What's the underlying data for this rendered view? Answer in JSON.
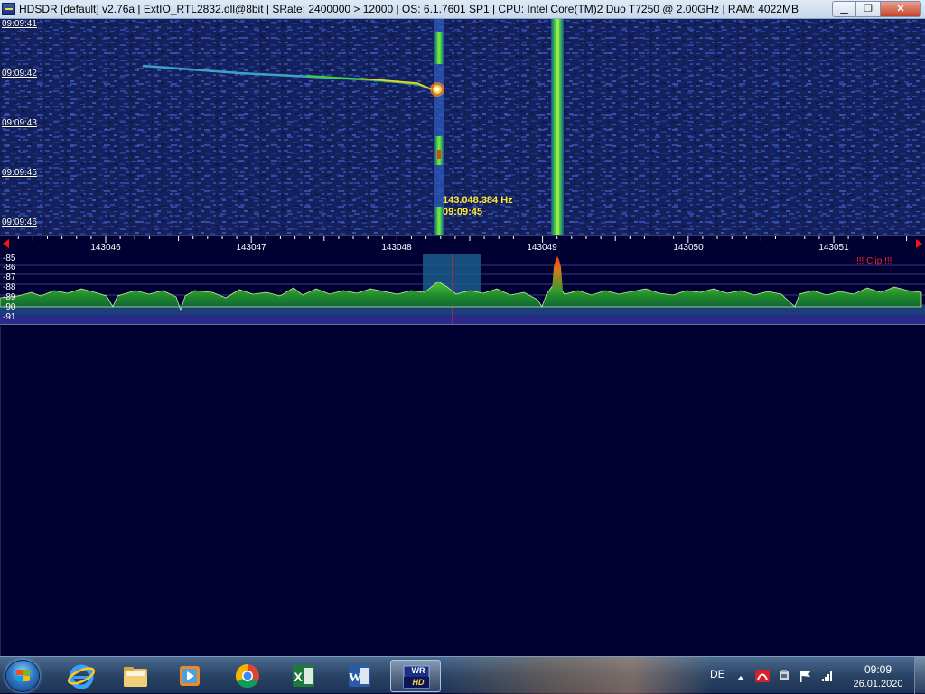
{
  "window": {
    "title": "HDSDR  [default]  v2.76a  |  ExtIO_RTL2832.dll@8bit  |  SRate: 2400000 > 12000  |  OS: 6.1.7601 SP1  |  CPU: Intel Core(TM)2 Duo      T7250  @ 2.00GHz  |  RAM: 4022MB",
    "minimize_glyph": "▁",
    "maximize_glyph": "❐",
    "close_glyph": "✕"
  },
  "waterfall": {
    "time_labels": [
      "09:09:41",
      "09:09:42",
      "09:09:43",
      "09:09:45",
      "09:09:46"
    ],
    "cursor_frequency": "143.048.384 Hz",
    "cursor_time": "09:09:45"
  },
  "frequency_scale": {
    "labels": [
      "143046",
      "143047",
      "143048",
      "143049",
      "143050",
      "143051"
    ]
  },
  "spectrum": {
    "db_labels": [
      "-85",
      "-86",
      "-87",
      "-88",
      "-89",
      "-90",
      "-91"
    ],
    "clip_warning": "!!! Clip !!!"
  },
  "taskbar": {
    "apps": [
      {
        "name": "internet-explorer",
        "icon": "ie-icon"
      },
      {
        "name": "windows-explorer",
        "icon": "folder-icon"
      },
      {
        "name": "media-player",
        "icon": "media-player-icon"
      },
      {
        "name": "chrome",
        "icon": "chrome-icon"
      },
      {
        "name": "excel",
        "icon": "excel-icon"
      },
      {
        "name": "word",
        "icon": "word-icon"
      },
      {
        "name": "winrad-hdsdr",
        "icon": "hdsdr-icon",
        "badge_top": "WR",
        "badge_bottom": "HD"
      }
    ],
    "language": "DE",
    "clock_time": "09:09",
    "clock_date": "26.01.2020"
  },
  "colors": {
    "waterfall_bg": "#14205a",
    "signal_hot": "#ffea2e",
    "signal_green": "#3cd23c",
    "spectrum_fill": "#1f8a2a",
    "passband": "#1a5a8a",
    "clip_red": "#ff2020"
  }
}
